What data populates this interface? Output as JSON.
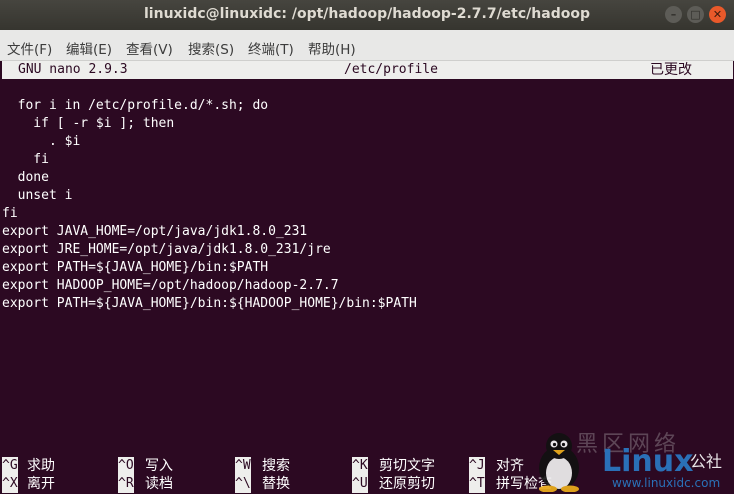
{
  "window": {
    "title": "linuxidc@linuxidc: /opt/hadoop/hadoop-2.7.7/etc/hadoop"
  },
  "menu": {
    "items": [
      "文件(F)",
      "编辑(E)",
      "查看(V)",
      "搜索(S)",
      "终端(T)",
      "帮助(H)"
    ]
  },
  "nano": {
    "version": "GNU nano 2.9.3",
    "filename": "/etc/profile",
    "status": "已更改"
  },
  "file_lines": [
    "",
    "  for i in /etc/profile.d/*.sh; do",
    "    if [ -r $i ]; then",
    "      . $i",
    "    fi",
    "  done",
    "  unset i",
    "fi",
    "export JAVA_HOME=/opt/java/jdk1.8.0_231",
    "export JRE_HOME=/opt/java/jdk1.8.0_231/jre",
    "export PATH=${JAVA_HOME}/bin:$PATH",
    "export HADOOP_HOME=/opt/hadoop/hadoop-2.7.7",
    "export PATH=${JAVA_HOME}/bin:${HADOOP_HOME}/bin:$PATH"
  ],
  "shortcuts": {
    "row1": [
      {
        "key": "^G",
        "label": "求助"
      },
      {
        "key": "^O",
        "label": "写入"
      },
      {
        "key": "^W",
        "label": "搜索"
      },
      {
        "key": "^K",
        "label": "剪切文字"
      },
      {
        "key": "^J",
        "label": "对齐"
      }
    ],
    "row2": [
      {
        "key": "^X",
        "label": "离开"
      },
      {
        "key": "^R",
        "label": "读档"
      },
      {
        "key": "^\\",
        "label": "替换"
      },
      {
        "key": "^U",
        "label": "还原剪切"
      },
      {
        "key": "^T",
        "label": "拼写检查"
      }
    ]
  },
  "watermark": {
    "cn": "黑区网络",
    "brand": "Linux",
    "gs": "公社",
    "url": "www.linuxidc.com"
  },
  "colors": {
    "terminal_bg": "#2c0922",
    "close_button": "#e9592a",
    "brand_blue": "#2a7cc8"
  }
}
